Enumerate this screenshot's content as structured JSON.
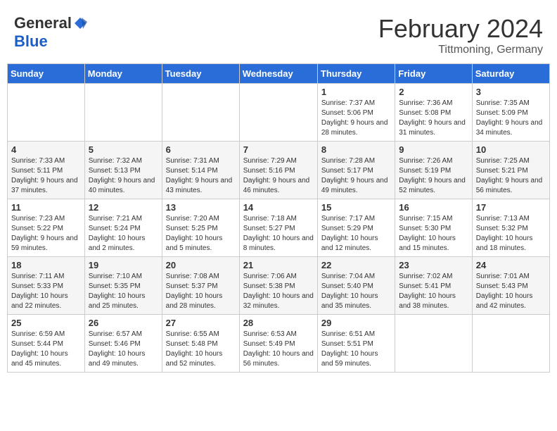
{
  "header": {
    "logo_general": "General",
    "logo_blue": "Blue",
    "month_title": "February 2024",
    "location": "Tittmoning, Germany"
  },
  "weekdays": [
    "Sunday",
    "Monday",
    "Tuesday",
    "Wednesday",
    "Thursday",
    "Friday",
    "Saturday"
  ],
  "weeks": [
    [
      {
        "day": "",
        "info": ""
      },
      {
        "day": "",
        "info": ""
      },
      {
        "day": "",
        "info": ""
      },
      {
        "day": "",
        "info": ""
      },
      {
        "day": "1",
        "info": "Sunrise: 7:37 AM\nSunset: 5:06 PM\nDaylight: 9 hours\nand 28 minutes."
      },
      {
        "day": "2",
        "info": "Sunrise: 7:36 AM\nSunset: 5:08 PM\nDaylight: 9 hours\nand 31 minutes."
      },
      {
        "day": "3",
        "info": "Sunrise: 7:35 AM\nSunset: 5:09 PM\nDaylight: 9 hours\nand 34 minutes."
      }
    ],
    [
      {
        "day": "4",
        "info": "Sunrise: 7:33 AM\nSunset: 5:11 PM\nDaylight: 9 hours\nand 37 minutes."
      },
      {
        "day": "5",
        "info": "Sunrise: 7:32 AM\nSunset: 5:13 PM\nDaylight: 9 hours\nand 40 minutes."
      },
      {
        "day": "6",
        "info": "Sunrise: 7:31 AM\nSunset: 5:14 PM\nDaylight: 9 hours\nand 43 minutes."
      },
      {
        "day": "7",
        "info": "Sunrise: 7:29 AM\nSunset: 5:16 PM\nDaylight: 9 hours\nand 46 minutes."
      },
      {
        "day": "8",
        "info": "Sunrise: 7:28 AM\nSunset: 5:17 PM\nDaylight: 9 hours\nand 49 minutes."
      },
      {
        "day": "9",
        "info": "Sunrise: 7:26 AM\nSunset: 5:19 PM\nDaylight: 9 hours\nand 52 minutes."
      },
      {
        "day": "10",
        "info": "Sunrise: 7:25 AM\nSunset: 5:21 PM\nDaylight: 9 hours\nand 56 minutes."
      }
    ],
    [
      {
        "day": "11",
        "info": "Sunrise: 7:23 AM\nSunset: 5:22 PM\nDaylight: 9 hours\nand 59 minutes."
      },
      {
        "day": "12",
        "info": "Sunrise: 7:21 AM\nSunset: 5:24 PM\nDaylight: 10 hours\nand 2 minutes."
      },
      {
        "day": "13",
        "info": "Sunrise: 7:20 AM\nSunset: 5:25 PM\nDaylight: 10 hours\nand 5 minutes."
      },
      {
        "day": "14",
        "info": "Sunrise: 7:18 AM\nSunset: 5:27 PM\nDaylight: 10 hours\nand 8 minutes."
      },
      {
        "day": "15",
        "info": "Sunrise: 7:17 AM\nSunset: 5:29 PM\nDaylight: 10 hours\nand 12 minutes."
      },
      {
        "day": "16",
        "info": "Sunrise: 7:15 AM\nSunset: 5:30 PM\nDaylight: 10 hours\nand 15 minutes."
      },
      {
        "day": "17",
        "info": "Sunrise: 7:13 AM\nSunset: 5:32 PM\nDaylight: 10 hours\nand 18 minutes."
      }
    ],
    [
      {
        "day": "18",
        "info": "Sunrise: 7:11 AM\nSunset: 5:33 PM\nDaylight: 10 hours\nand 22 minutes."
      },
      {
        "day": "19",
        "info": "Sunrise: 7:10 AM\nSunset: 5:35 PM\nDaylight: 10 hours\nand 25 minutes."
      },
      {
        "day": "20",
        "info": "Sunrise: 7:08 AM\nSunset: 5:37 PM\nDaylight: 10 hours\nand 28 minutes."
      },
      {
        "day": "21",
        "info": "Sunrise: 7:06 AM\nSunset: 5:38 PM\nDaylight: 10 hours\nand 32 minutes."
      },
      {
        "day": "22",
        "info": "Sunrise: 7:04 AM\nSunset: 5:40 PM\nDaylight: 10 hours\nand 35 minutes."
      },
      {
        "day": "23",
        "info": "Sunrise: 7:02 AM\nSunset: 5:41 PM\nDaylight: 10 hours\nand 38 minutes."
      },
      {
        "day": "24",
        "info": "Sunrise: 7:01 AM\nSunset: 5:43 PM\nDaylight: 10 hours\nand 42 minutes."
      }
    ],
    [
      {
        "day": "25",
        "info": "Sunrise: 6:59 AM\nSunset: 5:44 PM\nDaylight: 10 hours\nand 45 minutes."
      },
      {
        "day": "26",
        "info": "Sunrise: 6:57 AM\nSunset: 5:46 PM\nDaylight: 10 hours\nand 49 minutes."
      },
      {
        "day": "27",
        "info": "Sunrise: 6:55 AM\nSunset: 5:48 PM\nDaylight: 10 hours\nand 52 minutes."
      },
      {
        "day": "28",
        "info": "Sunrise: 6:53 AM\nSunset: 5:49 PM\nDaylight: 10 hours\nand 56 minutes."
      },
      {
        "day": "29",
        "info": "Sunrise: 6:51 AM\nSunset: 5:51 PM\nDaylight: 10 hours\nand 59 minutes."
      },
      {
        "day": "",
        "info": ""
      },
      {
        "day": "",
        "info": ""
      }
    ]
  ]
}
